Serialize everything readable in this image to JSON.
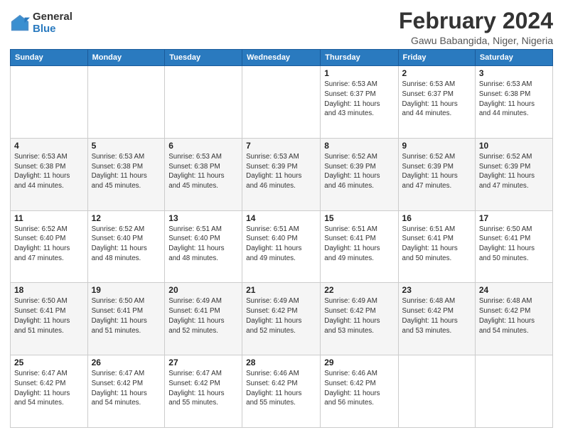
{
  "logo": {
    "general": "General",
    "blue": "Blue"
  },
  "title": "February 2024",
  "subtitle": "Gawu Babangida, Niger, Nigeria",
  "days_header": [
    "Sunday",
    "Monday",
    "Tuesday",
    "Wednesday",
    "Thursday",
    "Friday",
    "Saturday"
  ],
  "weeks": [
    [
      {
        "day": "",
        "info": ""
      },
      {
        "day": "",
        "info": ""
      },
      {
        "day": "",
        "info": ""
      },
      {
        "day": "",
        "info": ""
      },
      {
        "day": "1",
        "info": "Sunrise: 6:53 AM\nSunset: 6:37 PM\nDaylight: 11 hours\nand 43 minutes."
      },
      {
        "day": "2",
        "info": "Sunrise: 6:53 AM\nSunset: 6:37 PM\nDaylight: 11 hours\nand 44 minutes."
      },
      {
        "day": "3",
        "info": "Sunrise: 6:53 AM\nSunset: 6:38 PM\nDaylight: 11 hours\nand 44 minutes."
      }
    ],
    [
      {
        "day": "4",
        "info": "Sunrise: 6:53 AM\nSunset: 6:38 PM\nDaylight: 11 hours\nand 44 minutes."
      },
      {
        "day": "5",
        "info": "Sunrise: 6:53 AM\nSunset: 6:38 PM\nDaylight: 11 hours\nand 45 minutes."
      },
      {
        "day": "6",
        "info": "Sunrise: 6:53 AM\nSunset: 6:38 PM\nDaylight: 11 hours\nand 45 minutes."
      },
      {
        "day": "7",
        "info": "Sunrise: 6:53 AM\nSunset: 6:39 PM\nDaylight: 11 hours\nand 46 minutes."
      },
      {
        "day": "8",
        "info": "Sunrise: 6:52 AM\nSunset: 6:39 PM\nDaylight: 11 hours\nand 46 minutes."
      },
      {
        "day": "9",
        "info": "Sunrise: 6:52 AM\nSunset: 6:39 PM\nDaylight: 11 hours\nand 47 minutes."
      },
      {
        "day": "10",
        "info": "Sunrise: 6:52 AM\nSunset: 6:39 PM\nDaylight: 11 hours\nand 47 minutes."
      }
    ],
    [
      {
        "day": "11",
        "info": "Sunrise: 6:52 AM\nSunset: 6:40 PM\nDaylight: 11 hours\nand 47 minutes."
      },
      {
        "day": "12",
        "info": "Sunrise: 6:52 AM\nSunset: 6:40 PM\nDaylight: 11 hours\nand 48 minutes."
      },
      {
        "day": "13",
        "info": "Sunrise: 6:51 AM\nSunset: 6:40 PM\nDaylight: 11 hours\nand 48 minutes."
      },
      {
        "day": "14",
        "info": "Sunrise: 6:51 AM\nSunset: 6:40 PM\nDaylight: 11 hours\nand 49 minutes."
      },
      {
        "day": "15",
        "info": "Sunrise: 6:51 AM\nSunset: 6:41 PM\nDaylight: 11 hours\nand 49 minutes."
      },
      {
        "day": "16",
        "info": "Sunrise: 6:51 AM\nSunset: 6:41 PM\nDaylight: 11 hours\nand 50 minutes."
      },
      {
        "day": "17",
        "info": "Sunrise: 6:50 AM\nSunset: 6:41 PM\nDaylight: 11 hours\nand 50 minutes."
      }
    ],
    [
      {
        "day": "18",
        "info": "Sunrise: 6:50 AM\nSunset: 6:41 PM\nDaylight: 11 hours\nand 51 minutes."
      },
      {
        "day": "19",
        "info": "Sunrise: 6:50 AM\nSunset: 6:41 PM\nDaylight: 11 hours\nand 51 minutes."
      },
      {
        "day": "20",
        "info": "Sunrise: 6:49 AM\nSunset: 6:41 PM\nDaylight: 11 hours\nand 52 minutes."
      },
      {
        "day": "21",
        "info": "Sunrise: 6:49 AM\nSunset: 6:42 PM\nDaylight: 11 hours\nand 52 minutes."
      },
      {
        "day": "22",
        "info": "Sunrise: 6:49 AM\nSunset: 6:42 PM\nDaylight: 11 hours\nand 53 minutes."
      },
      {
        "day": "23",
        "info": "Sunrise: 6:48 AM\nSunset: 6:42 PM\nDaylight: 11 hours\nand 53 minutes."
      },
      {
        "day": "24",
        "info": "Sunrise: 6:48 AM\nSunset: 6:42 PM\nDaylight: 11 hours\nand 54 minutes."
      }
    ],
    [
      {
        "day": "25",
        "info": "Sunrise: 6:47 AM\nSunset: 6:42 PM\nDaylight: 11 hours\nand 54 minutes."
      },
      {
        "day": "26",
        "info": "Sunrise: 6:47 AM\nSunset: 6:42 PM\nDaylight: 11 hours\nand 54 minutes."
      },
      {
        "day": "27",
        "info": "Sunrise: 6:47 AM\nSunset: 6:42 PM\nDaylight: 11 hours\nand 55 minutes."
      },
      {
        "day": "28",
        "info": "Sunrise: 6:46 AM\nSunset: 6:42 PM\nDaylight: 11 hours\nand 55 minutes."
      },
      {
        "day": "29",
        "info": "Sunrise: 6:46 AM\nSunset: 6:42 PM\nDaylight: 11 hours\nand 56 minutes."
      },
      {
        "day": "",
        "info": ""
      },
      {
        "day": "",
        "info": ""
      }
    ]
  ]
}
